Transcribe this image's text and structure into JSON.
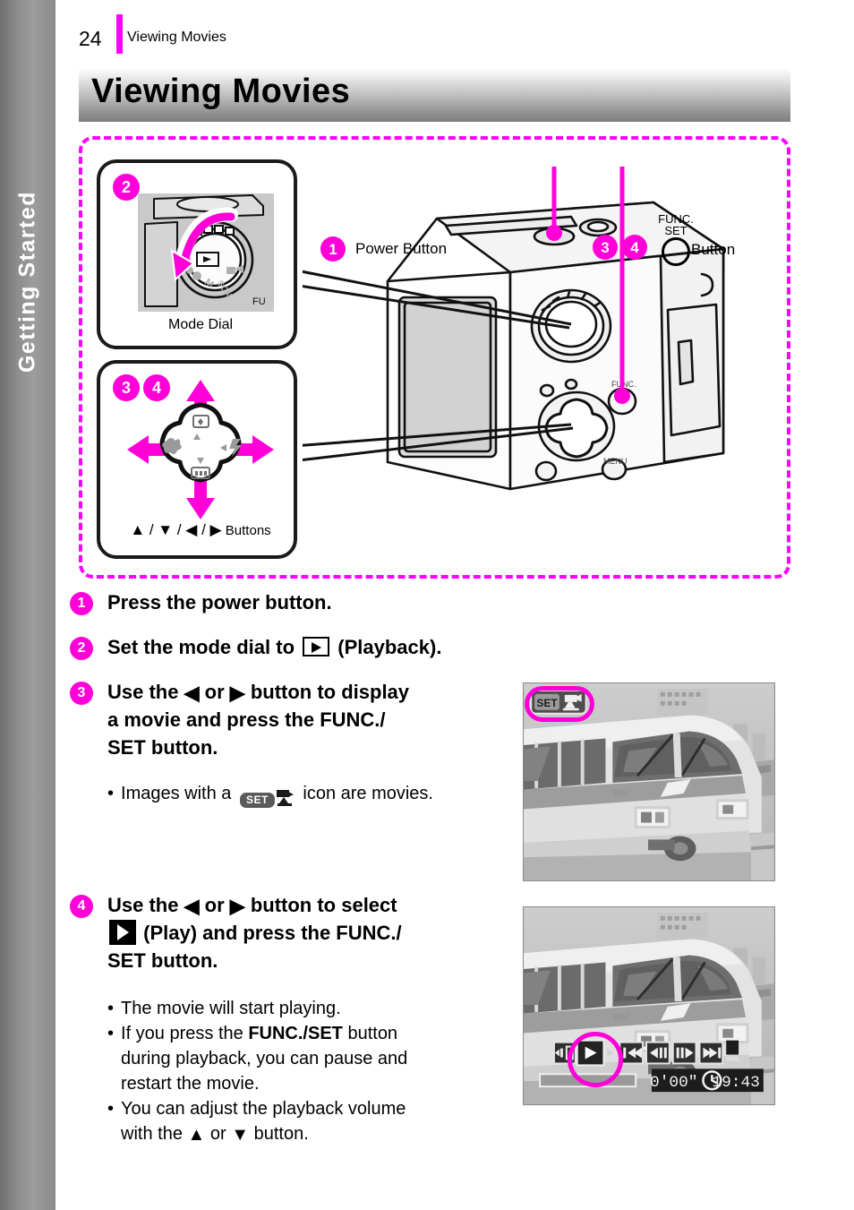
{
  "chapter_tab": {
    "label": "Getting Started"
  },
  "header": {
    "page_number": "24",
    "breadcrumb": "Viewing Movies",
    "rule_color": "#ff00ff"
  },
  "title_banner": {
    "title": "Viewing Movies"
  },
  "diagram": {
    "border_color": "#ff00ff",
    "callout_mode_dial": {
      "badge": "2",
      "caption": "Mode Dial"
    },
    "callout_dpad": {
      "badge_a": "3",
      "badge_b": "4",
      "caption_prefix": "▲ / ▼ / ◀ / ▶",
      "caption": "Buttons"
    },
    "power_button": {
      "badge": "1",
      "label": "Power Button"
    },
    "funcset_button": {
      "badge_a": "3",
      "badge_b": "4",
      "icon_line1": "FUNC.",
      "icon_line2": "SET",
      "label": "Button"
    }
  },
  "steps": [
    {
      "badge": "1",
      "text": "Press the power button."
    },
    {
      "badge": "2",
      "text_before": "Set the mode dial to",
      "icon": "playback-icon",
      "text_after": "(Playback)."
    },
    {
      "badge": "3",
      "line1_a": "Use the",
      "line1_tri_left": "◀",
      "line1_b": "or",
      "line1_tri_right": "▶",
      "line1_c": "button to display",
      "line2": "a movie and press the FUNC./",
      "line3": "SET button.",
      "notes": [
        {
          "bullet": "•",
          "text_before": "Images with a",
          "icon": "set-movie-icon",
          "icon_label": "SET",
          "text_after": "icon are movies."
        }
      ]
    },
    {
      "badge": "4",
      "line1_a": "Use the",
      "line1_tri_left": "◀",
      "line1_b": "or",
      "line1_tri_right": "▶",
      "line1_c": "button to select",
      "line2_icon": "play-solid-icon",
      "line2": "(Play) and press the FUNC./",
      "line3": "SET button.",
      "notes": [
        {
          "bullet": "•",
          "text": "The movie will start playing."
        },
        {
          "bullet": "•",
          "text_before": "If you press the",
          "bold": "FUNC./SET",
          "text_after": "button",
          "line2": "during playback, you can pause and",
          "line3": "restart the movie."
        },
        {
          "bullet": "•",
          "text": "You can adjust the playback volume",
          "line2_a": "with the",
          "line2_tri_up": "▲",
          "line2_b": "or",
          "line2_tri_down": "▼",
          "line2_c": "button."
        }
      ]
    }
  ],
  "photos": {
    "top": {
      "subject": "monorail-train-photo",
      "osd_set_label": "SET",
      "highlight_color": "#ff00d8"
    },
    "bottom": {
      "subject": "monorail-train-photo",
      "elapsed_time": "0'00\"",
      "clock_time": "19:43",
      "clock_icon": "clock-icon",
      "controls": [
        "exit-icon",
        "play-icon",
        "rewind-icon",
        "prev-frame-icon",
        "next-frame-icon",
        "fast-forward-icon",
        "stop-icon"
      ],
      "highlight_color": "#ff00d8"
    }
  }
}
